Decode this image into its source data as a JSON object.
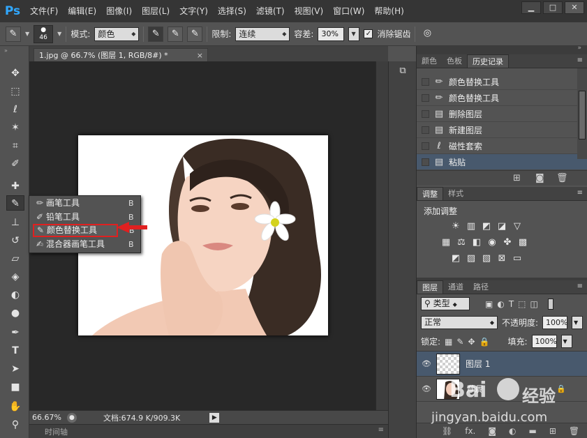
{
  "app": {
    "logo": "Ps"
  },
  "menubar": [
    "文件(F)",
    "编辑(E)",
    "图像(I)",
    "图层(L)",
    "文字(Y)",
    "选择(S)",
    "滤镜(T)",
    "视图(V)",
    "窗口(W)",
    "帮助(H)"
  ],
  "window_buttons": {
    "minimize": "▁",
    "maximize": "□",
    "close": "✕"
  },
  "options": {
    "brush_size": "46",
    "mode_label": "模式:",
    "mode_value": "颜色",
    "limit_label": "限制:",
    "limit_value": "连续",
    "tolerance_label": "容差:",
    "tolerance_value": "30%",
    "antialias_label": "消除锯齿",
    "antialias_checked": "✓"
  },
  "document": {
    "tab_title": "1.jpg @ 66.7% (图层 1, RGB/8#) *",
    "tab_close": "×"
  },
  "status": {
    "zoom": "66.67%",
    "doc_info": "文档:674.9 K/909.3K",
    "arrow": "▶"
  },
  "timeline": {
    "label": "时间轴"
  },
  "flyout": {
    "items": [
      {
        "label": "画笔工具",
        "key": "B",
        "icon": "brush-icon"
      },
      {
        "label": "铅笔工具",
        "key": "B",
        "icon": "pencil-icon"
      },
      {
        "label": "颜色替换工具",
        "key": "B",
        "icon": "color-replacement-icon"
      },
      {
        "label": "混合器画笔工具",
        "key": "B",
        "icon": "mixer-brush-icon"
      }
    ]
  },
  "history_panel": {
    "tabs": [
      "颜色",
      "色板",
      "历史记录"
    ],
    "rows": [
      {
        "label": "颜色替换工具",
        "icon": "brush-icon"
      },
      {
        "label": "颜色替换工具",
        "icon": "brush-icon"
      },
      {
        "label": "删除图层",
        "icon": "document-icon"
      },
      {
        "label": "新建图层",
        "icon": "document-icon"
      },
      {
        "label": "磁性套索",
        "icon": "magnetic-lasso-icon"
      },
      {
        "label": "粘贴",
        "icon": "document-icon"
      }
    ]
  },
  "adjustments_panel": {
    "tabs": [
      "调整",
      "样式"
    ],
    "title": "添加调整"
  },
  "layers_panel": {
    "tabs": [
      "图层",
      "通道",
      "路径"
    ],
    "filter_value": "类型",
    "blend_mode": "正常",
    "opacity_label": "不透明度:",
    "opacity_value": "100%",
    "lock_label": "锁定:",
    "fill_label": "填充:",
    "fill_value": "100%",
    "layers": [
      {
        "name": "图层 1",
        "selected": true
      },
      {
        "name": "背景",
        "selected": false
      }
    ],
    "footer": [
      "fx."
    ]
  },
  "watermark": {
    "brand": "Bai",
    "brand2": "经验",
    "url": "jingyan.baidu.com"
  },
  "colors": {
    "accent_blue": "#31a8ff",
    "selection": "#48596d",
    "highlight_red": "#e02020"
  }
}
